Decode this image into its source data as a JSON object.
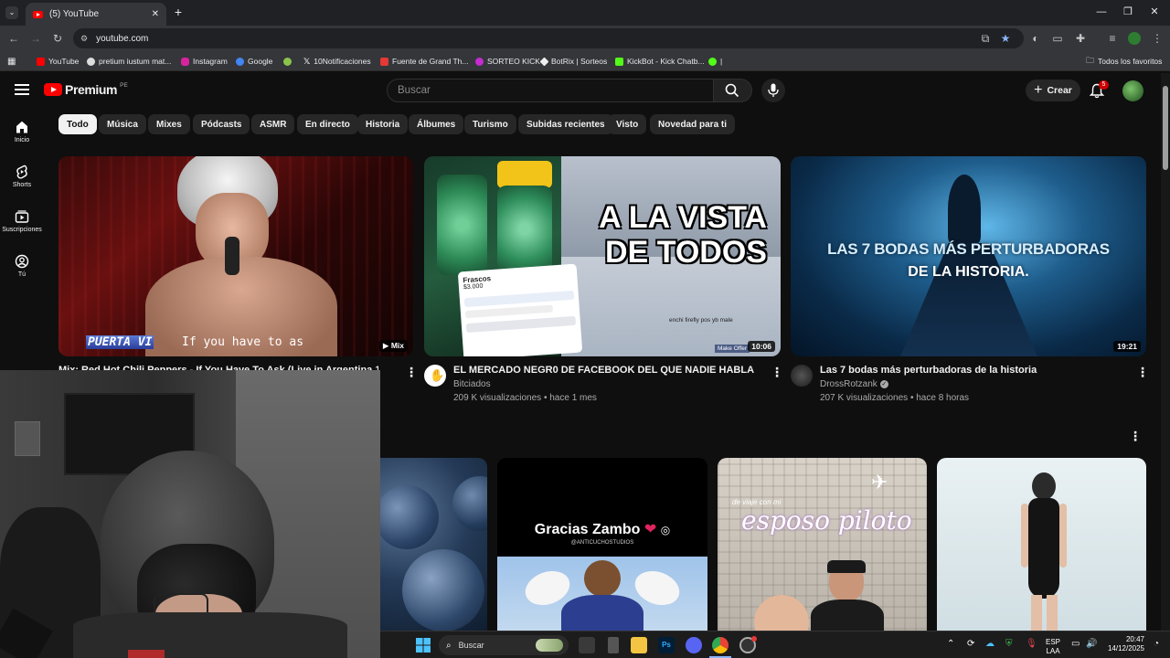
{
  "browser": {
    "tab_title": "(5) YouTube",
    "new_tab": "+",
    "url": "youtube.com",
    "bookmarks": [
      {
        "label": "YouTube",
        "color": "#ff0000"
      },
      {
        "label": "pretium iustum mat...",
        "color": "#dddddd"
      },
      {
        "label": "Instagram",
        "color": "#d6249f"
      },
      {
        "label": "Google",
        "color": "#4285f4"
      },
      {
        "label": "",
        "color": "#8bc34a"
      },
      {
        "label": "10Notificaciones",
        "color": "#ffffff"
      },
      {
        "label": "Fuente de Grand Th...",
        "color": "#e53935"
      },
      {
        "label": "SORTEO KICK",
        "color": "#c62ad1"
      },
      {
        "label": "BotRix | Sorteos",
        "color": "#eeeeee"
      },
      {
        "label": "KickBot - Kick Chatb...",
        "color": "#53fc18"
      },
      {
        "label": "|",
        "color": "#53fc18"
      }
    ],
    "all_bookmarks": "Todos los favoritos"
  },
  "youtube": {
    "logo_text": "Premium",
    "logo_region": "PE",
    "search_placeholder": "Buscar",
    "create_label": "Crear",
    "notification_count": "5",
    "guide": [
      {
        "label": "Inicio",
        "icon": "home-icon"
      },
      {
        "label": "Shorts",
        "icon": "shorts-icon"
      },
      {
        "label": "Suscripciones",
        "icon": "subscriptions-icon"
      },
      {
        "label": "Tú",
        "icon": "you-icon"
      }
    ],
    "chips": [
      "Todo",
      "Música",
      "Mixes",
      "Pódcasts",
      "ASMR",
      "En directo",
      "Historia",
      "Álbumes",
      "Turismo",
      "Subidas recientes",
      "Visto",
      "Novedad para ti"
    ],
    "videos": [
      {
        "title": "Mix: Red Hot Chili Peppers - If You Have To Ask (Live in Argentina 1999)",
        "badge": "Mix",
        "caption_text": "If you have to as",
        "corner_text": "PUERTA VI"
      },
      {
        "title": "EL MERCADO NEGR0 DE FACEBOOK DEL QUE NADIE HABLA",
        "channel": "Bitciados",
        "views": "209 K visualizaciones",
        "age": "hace 1 mes",
        "duration": "10:06",
        "thumb_line1": "A LA VISTA",
        "thumb_line2": "DE TODOS",
        "mock_card_title": "Frascos",
        "mock_card_price": "$3.000",
        "mock_listing1": "enchi firefly pos yb male",
        "mock_listing2": "Make Offer"
      },
      {
        "title": "Las 7 bodas más perturbadoras de la historia",
        "channel": "DrossRotzank",
        "views": "207 K visualizaciones",
        "age": "hace 8 horas",
        "duration": "19:21",
        "thumb_line1": "LAS 7 BODAS MÁS PERTURBADORAS",
        "thumb_line2": "DE LA HISTORIA."
      }
    ],
    "shorts": [
      {
        "overlay": ""
      },
      {
        "overlay": "Gracias Zambo",
        "sub": "@ANTICUCHOSTUDIOS"
      },
      {
        "overlay": "esposo piloto",
        "sub": "de viaje con mi"
      },
      {
        "overlay": ""
      }
    ]
  },
  "taskbar": {
    "search_placeholder": "Buscar",
    "language_top": "ESP",
    "language_bottom": "LAA",
    "time": "20:47",
    "date": "14/12/2025"
  }
}
